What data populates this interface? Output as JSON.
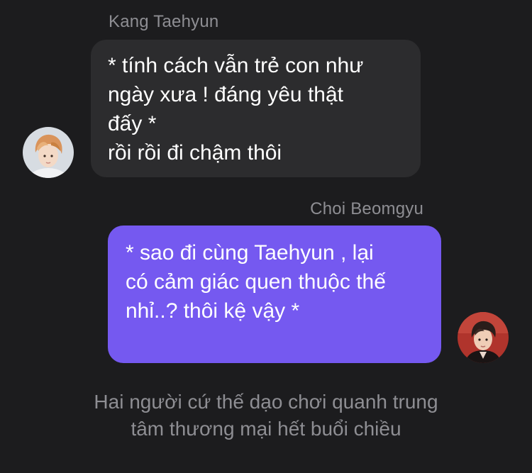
{
  "messages": [
    {
      "sender": "Kang Taehyun",
      "lines": [
        "* tính cách vẫn trẻ con như",
        "ngày xưa ! đáng yêu thật",
        "đấy *",
        "rồi rồi đi chậm thôi"
      ],
      "side": "left",
      "bubble_color": "#2c2c2e"
    },
    {
      "sender": "Choi Beomgyu",
      "lines": [
        "* sao đi cùng Taehyun , lại",
        "có cảm giác quen thuộc thế",
        "nhỉ..? thôi kệ vậy *"
      ],
      "side": "right",
      "bubble_color": "#7559f0"
    }
  ],
  "narration": {
    "lines": [
      "Hai người cứ thế dạo chơi quanh trung",
      "tâm thương mại hết buổi chiều"
    ]
  },
  "colors": {
    "background": "#1c1c1e",
    "name_text": "#8e8e93",
    "narration_text": "#8e8e93"
  }
}
